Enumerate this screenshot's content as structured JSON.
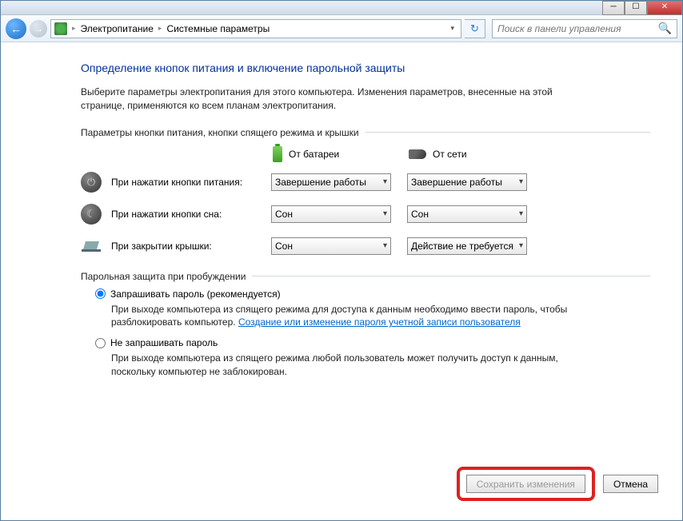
{
  "nav": {
    "breadcrumb1": "Электропитание",
    "breadcrumb2": "Системные параметры",
    "search_placeholder": "Поиск в панели управления"
  },
  "heading": "Определение кнопок питания и включение парольной защиты",
  "intro": "Выберите параметры электропитания для этого компьютера. Изменения параметров, внесенные на этой странице, применяются ко всем планам электропитания.",
  "section1_title": "Параметры кнопки питания, кнопки спящего режима и крышки",
  "columns": {
    "battery": "От батареи",
    "ac": "От сети"
  },
  "rows": {
    "power": {
      "label": "При нажатии кнопки питания:",
      "battery": "Завершение работы",
      "ac": "Завершение работы"
    },
    "sleep": {
      "label": "При нажатии кнопки сна:",
      "battery": "Сон",
      "ac": "Сон"
    },
    "lid": {
      "label": "При закрытии крышки:",
      "battery": "Сон",
      "ac": "Действие не требуется"
    }
  },
  "section2_title": "Парольная защита при пробуждении",
  "pw": {
    "opt1_label": "Запрашивать пароль (рекомендуется)",
    "opt1_desc_a": "При выходе компьютера из спящего режима для доступа к данным необходимо ввести пароль, чтобы разблокировать компьютер. ",
    "opt1_link": "Создание или изменение пароля учетной записи пользователя",
    "opt2_label": "Не запрашивать пароль",
    "opt2_desc": "При выходе компьютера из спящего режима любой пользователь может получить доступ к данным, поскольку компьютер не заблокирован."
  },
  "buttons": {
    "save": "Сохранить изменения",
    "cancel": "Отмена"
  }
}
